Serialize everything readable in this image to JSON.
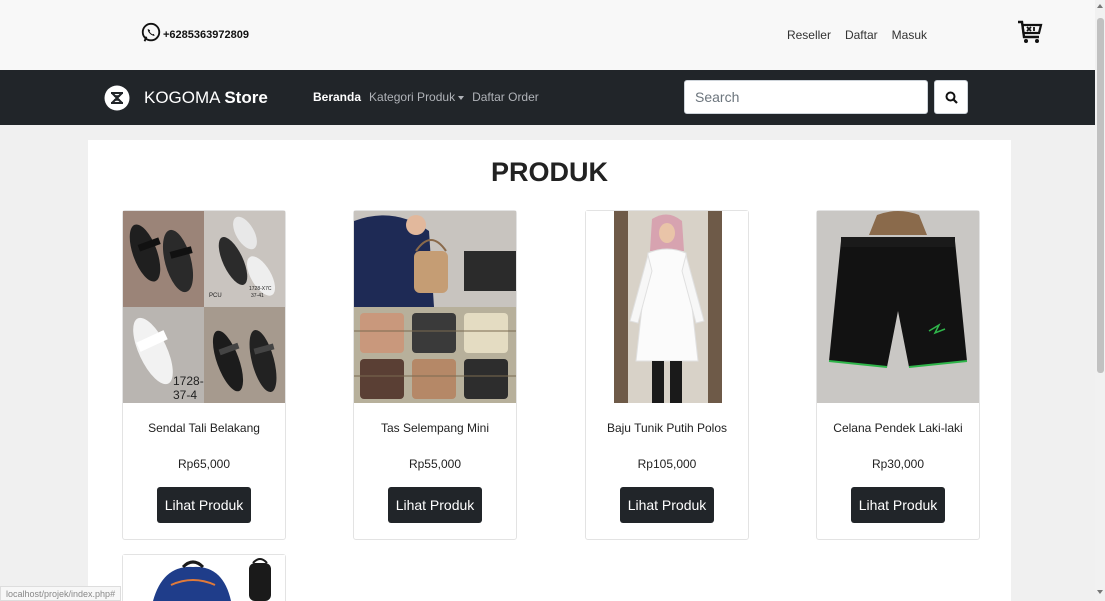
{
  "topbar": {
    "phone": "+6285363972809",
    "links": [
      "Reseller",
      "Daftar",
      "Masuk"
    ]
  },
  "navbar": {
    "brand_light": "KOGOMA",
    "brand_bold": "Store",
    "items": [
      {
        "label": "Beranda",
        "active": true
      },
      {
        "label": "Kategori Produk",
        "dropdown": true
      },
      {
        "label": "Daftar Order"
      }
    ],
    "search": {
      "placeholder": "Search",
      "value": ""
    }
  },
  "main": {
    "title": "PRODUK",
    "products": [
      {
        "name": "Sendal Tali Belakang",
        "price": "Rp65,000",
        "button": "Lihat Produk",
        "thumb_text": [
          "PCU",
          "1728-X7C",
          "37-41",
          "1728-",
          "37-4"
        ]
      },
      {
        "name": "Tas Selempang Mini",
        "price": "Rp55,000",
        "button": "Lihat Produk"
      },
      {
        "name": "Baju Tunik Putih Polos",
        "price": "Rp105,000",
        "button": "Lihat Produk"
      },
      {
        "name": "Celana Pendek Laki-laki",
        "price": "Rp30,000",
        "button": "Lihat Produk"
      }
    ]
  },
  "status_url": "localhost/projek/index.php#",
  "colors": {
    "navbar": "#212529",
    "button": "#212529",
    "page_bg": "#f0f0f0"
  },
  "icons": [
    "whatsapp-icon",
    "cart-icon",
    "logo-icon",
    "search-icon"
  ]
}
